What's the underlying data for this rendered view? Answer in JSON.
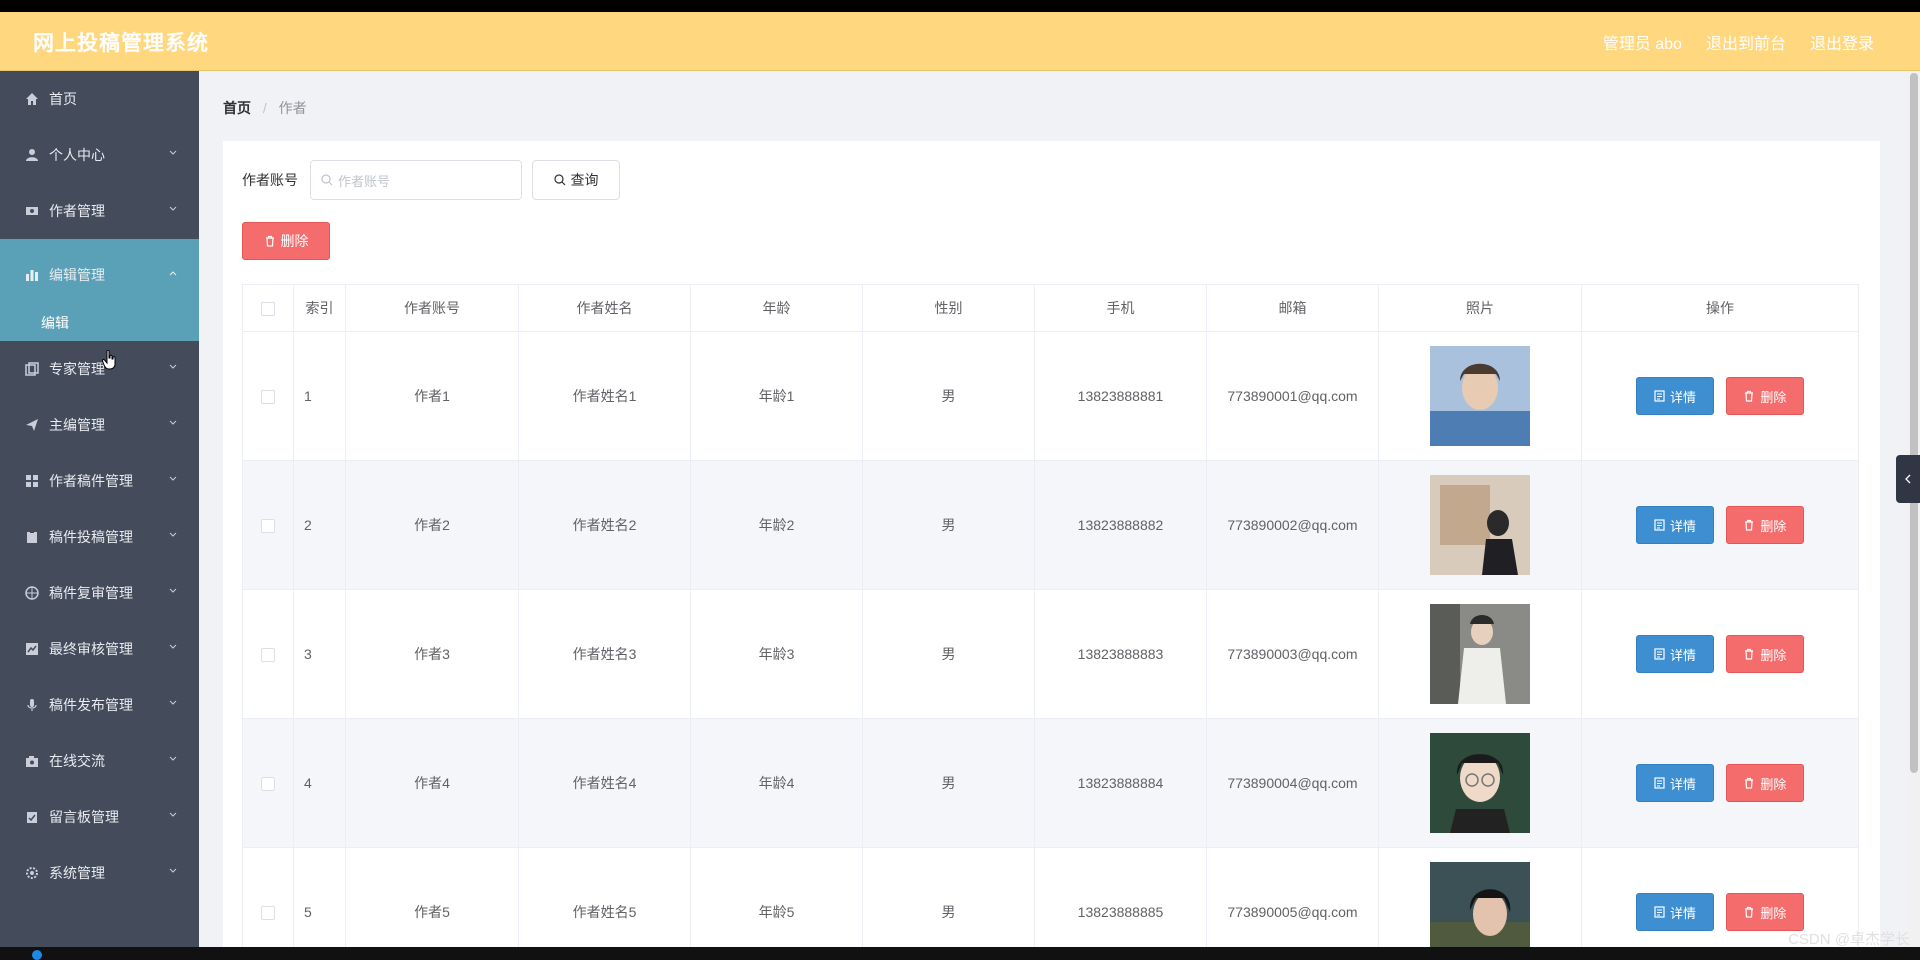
{
  "app": {
    "title": "网上投稿管理系统",
    "top_links": [
      "管理员 abo",
      "退出到前台",
      "退出登录"
    ],
    "colors": {
      "topbar": "#ffd77e",
      "sidebar": "#444c5c",
      "active_menu": "#5aa1b8",
      "danger": "#f56c6c",
      "primary": "#3d8fd1"
    }
  },
  "sidebar": {
    "items": [
      {
        "label": "首页",
        "icon": "home-icon",
        "has_children": false
      },
      {
        "label": "个人中心",
        "icon": "user-icon",
        "has_children": true
      },
      {
        "label": "作者管理",
        "icon": "ticket-icon",
        "has_children": true
      },
      {
        "label": "编辑管理",
        "icon": "chart-bar-icon",
        "has_children": true,
        "active": true,
        "children": [
          "编辑"
        ]
      },
      {
        "label": "专家管理",
        "icon": "copy-icon",
        "has_children": true
      },
      {
        "label": "主编管理",
        "icon": "send-icon",
        "has_children": true
      },
      {
        "label": "作者稿件管理",
        "icon": "grid-icon",
        "has_children": true
      },
      {
        "label": "稿件投稿管理",
        "icon": "clipboard-icon",
        "has_children": true
      },
      {
        "label": "稿件复审管理",
        "icon": "basketball-icon",
        "has_children": true
      },
      {
        "label": "最终审核管理",
        "icon": "trend-icon",
        "has_children": true
      },
      {
        "label": "稿件发布管理",
        "icon": "microphone-icon",
        "has_children": true
      },
      {
        "label": "在线交流",
        "icon": "camera-icon",
        "has_children": true
      },
      {
        "label": "留言板管理",
        "icon": "clipboard-check-icon",
        "has_children": true
      },
      {
        "label": "系统管理",
        "icon": "setting-icon",
        "has_children": true
      }
    ]
  },
  "breadcrumb": {
    "home": "首页",
    "separator": "/",
    "current": "作者"
  },
  "search": {
    "label": "作者账号",
    "placeholder": "作者账号",
    "query_button": "查询"
  },
  "toolbar": {
    "delete_button": "删除"
  },
  "table": {
    "columns": [
      "",
      "索引",
      "作者账号",
      "作者姓名",
      "年龄",
      "性别",
      "手机",
      "邮箱",
      "照片",
      "操作"
    ],
    "rows": [
      {
        "index": "1",
        "account": "作者1",
        "name": "作者姓名1",
        "age": "年龄1",
        "gender": "男",
        "phone": "13823888881",
        "email": "773890001@qq.com"
      },
      {
        "index": "2",
        "account": "作者2",
        "name": "作者姓名2",
        "age": "年龄2",
        "gender": "男",
        "phone": "13823888882",
        "email": "773890002@qq.com"
      },
      {
        "index": "3",
        "account": "作者3",
        "name": "作者姓名3",
        "age": "年龄3",
        "gender": "男",
        "phone": "13823888883",
        "email": "773890003@qq.com"
      },
      {
        "index": "4",
        "account": "作者4",
        "name": "作者姓名4",
        "age": "年龄4",
        "gender": "男",
        "phone": "13823888884",
        "email": "773890004@qq.com"
      },
      {
        "index": "5",
        "account": "作者5",
        "name": "作者姓名5",
        "age": "年龄5",
        "gender": "男",
        "phone": "13823888885",
        "email": "773890005@qq.com"
      }
    ],
    "detail_label": "详情",
    "delete_label": "删除"
  },
  "watermark": "CSDN @卓杰学长"
}
